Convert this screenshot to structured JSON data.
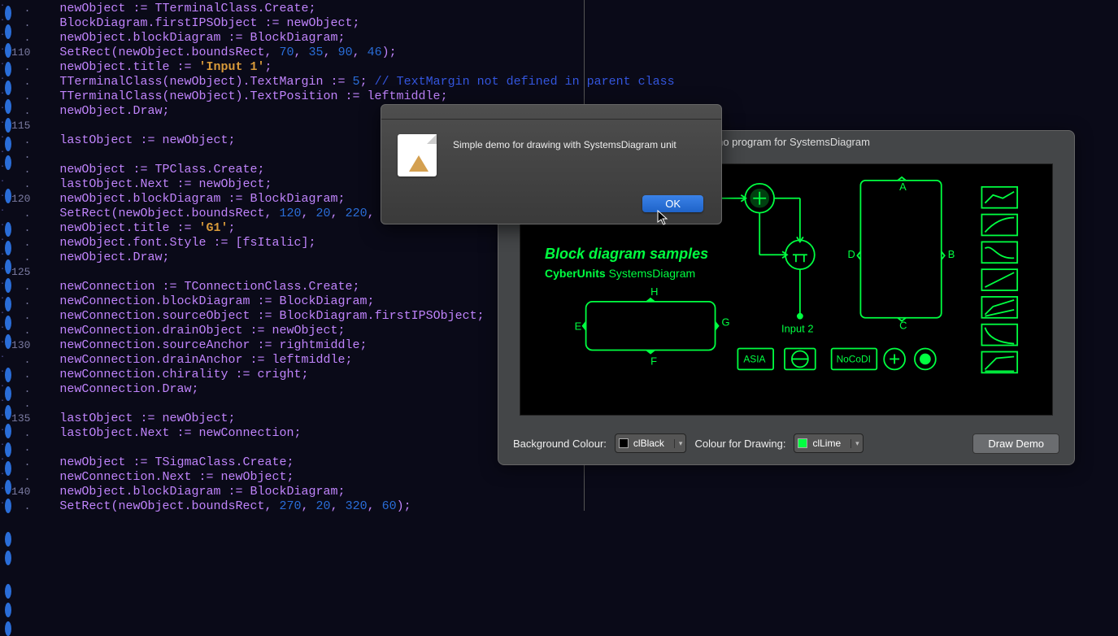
{
  "editor": {
    "first_line": 107,
    "breakpoint_lines": [
      107,
      108,
      109,
      110,
      111,
      112,
      113,
      114,
      115,
      117,
      119,
      120,
      121,
      122,
      123,
      124,
      125,
      127,
      128,
      129,
      130,
      131,
      132,
      133,
      134,
      136,
      137,
      139,
      140,
      141,
      142
    ],
    "lines": [
      {
        "n": 107,
        "t": [
          [
            "newObject ",
            0
          ],
          [
            ":=",
            1
          ],
          [
            " TTerminalClass",
            0
          ],
          [
            ".",
            1
          ],
          [
            "Create",
            0
          ],
          [
            ";",
            1
          ]
        ]
      },
      {
        "n": 108,
        "t": [
          [
            "BlockDiagram",
            0
          ],
          [
            ".",
            1
          ],
          [
            "firstIPSObject ",
            0
          ],
          [
            ":=",
            1
          ],
          [
            " newObject",
            0
          ],
          [
            ";",
            1
          ]
        ]
      },
      {
        "n": 109,
        "t": [
          [
            "newObject",
            0
          ],
          [
            ".",
            1
          ],
          [
            "blockDiagram ",
            0
          ],
          [
            ":=",
            1
          ],
          [
            " BlockDiagram",
            0
          ],
          [
            ";",
            1
          ]
        ]
      },
      {
        "n": 110,
        "t": [
          [
            "SetRect",
            0
          ],
          [
            "(",
            1
          ],
          [
            "newObject",
            0
          ],
          [
            ".",
            1
          ],
          [
            "boundsRect",
            0
          ],
          [
            ", ",
            1
          ],
          [
            "70",
            2
          ],
          [
            ", ",
            1
          ],
          [
            "35",
            2
          ],
          [
            ", ",
            1
          ],
          [
            "90",
            2
          ],
          [
            ", ",
            1
          ],
          [
            "46",
            2
          ],
          [
            ");",
            1
          ]
        ]
      },
      {
        "n": 111,
        "t": [
          [
            "newObject",
            0
          ],
          [
            ".",
            1
          ],
          [
            "title ",
            0
          ],
          [
            ":= ",
            1
          ],
          [
            "'Input 1'",
            3
          ],
          [
            ";",
            1
          ]
        ]
      },
      {
        "n": 112,
        "t": [
          [
            "TTerminalClass",
            0
          ],
          [
            "(",
            1
          ],
          [
            "newObject",
            0
          ],
          [
            ").",
            1
          ],
          [
            "TextMargin ",
            0
          ],
          [
            ":= ",
            1
          ],
          [
            "5",
            2
          ],
          [
            "; ",
            1
          ],
          [
            "// TextMargin not defined in parent class",
            4
          ]
        ]
      },
      {
        "n": 113,
        "t": [
          [
            "TTerminalClass",
            0
          ],
          [
            "(",
            1
          ],
          [
            "newObject",
            0
          ],
          [
            ").",
            1
          ],
          [
            "TextPosition ",
            0
          ],
          [
            ":= ",
            1
          ],
          [
            "leftmiddle",
            0
          ],
          [
            ";",
            1
          ]
        ]
      },
      {
        "n": 114,
        "t": [
          [
            "newObject",
            0
          ],
          [
            ".",
            1
          ],
          [
            "Draw",
            0
          ],
          [
            ";",
            1
          ]
        ]
      },
      {
        "n": 115,
        "t": [
          [
            " ",
            0
          ]
        ]
      },
      {
        "n": 116,
        "t": [
          [
            "lastObject ",
            0
          ],
          [
            ":=",
            1
          ],
          [
            " newObject",
            0
          ],
          [
            ";",
            1
          ]
        ]
      },
      {
        "n": 117,
        "t": [
          [
            " ",
            0
          ]
        ]
      },
      {
        "n": 118,
        "t": [
          [
            "newObject ",
            0
          ],
          [
            ":=",
            1
          ],
          [
            " TPClass",
            0
          ],
          [
            ".",
            1
          ],
          [
            "Create",
            0
          ],
          [
            ";",
            1
          ]
        ]
      },
      {
        "n": 119,
        "t": [
          [
            "lastObject",
            0
          ],
          [
            ".",
            1
          ],
          [
            "Next ",
            0
          ],
          [
            ":=",
            1
          ],
          [
            " newObject",
            0
          ],
          [
            ";",
            1
          ]
        ]
      },
      {
        "n": 120,
        "t": [
          [
            "newObject",
            0
          ],
          [
            ".",
            1
          ],
          [
            "blockDiagram ",
            0
          ],
          [
            ":=",
            1
          ],
          [
            " BlockDiagram",
            0
          ],
          [
            ";",
            1
          ]
        ]
      },
      {
        "n": 121,
        "t": [
          [
            "SetRect",
            0
          ],
          [
            "(",
            1
          ],
          [
            "newObject",
            0
          ],
          [
            ".",
            1
          ],
          [
            "boundsRect",
            0
          ],
          [
            ", ",
            1
          ],
          [
            "120",
            2
          ],
          [
            ", ",
            1
          ],
          [
            "20",
            2
          ],
          [
            ", ",
            1
          ],
          [
            "220",
            2
          ],
          [
            ",",
            1
          ]
        ]
      },
      {
        "n": 122,
        "t": [
          [
            "newObject",
            0
          ],
          [
            ".",
            1
          ],
          [
            "title ",
            0
          ],
          [
            ":= ",
            1
          ],
          [
            "'G1'",
            3
          ],
          [
            ";",
            1
          ]
        ]
      },
      {
        "n": 123,
        "t": [
          [
            "newObject",
            0
          ],
          [
            ".",
            1
          ],
          [
            "font",
            0
          ],
          [
            ".",
            1
          ],
          [
            "Style ",
            0
          ],
          [
            ":= [",
            1
          ],
          [
            "fsItalic",
            0
          ],
          [
            "];",
            1
          ]
        ]
      },
      {
        "n": 124,
        "t": [
          [
            "newObject",
            0
          ],
          [
            ".",
            1
          ],
          [
            "Draw",
            0
          ],
          [
            ";",
            1
          ]
        ]
      },
      {
        "n": 125,
        "t": [
          [
            " ",
            0
          ]
        ]
      },
      {
        "n": 126,
        "t": [
          [
            "newConnection ",
            0
          ],
          [
            ":=",
            1
          ],
          [
            " TConnectionClass",
            0
          ],
          [
            ".",
            1
          ],
          [
            "Create",
            0
          ],
          [
            ";",
            1
          ]
        ]
      },
      {
        "n": 127,
        "t": [
          [
            "newConnection",
            0
          ],
          [
            ".",
            1
          ],
          [
            "blockDiagram ",
            0
          ],
          [
            ":=",
            1
          ],
          [
            " BlockDiagram",
            0
          ],
          [
            ";",
            1
          ]
        ]
      },
      {
        "n": 128,
        "t": [
          [
            "newConnection",
            0
          ],
          [
            ".",
            1
          ],
          [
            "sourceObject ",
            0
          ],
          [
            ":=",
            1
          ],
          [
            " BlockDiagram",
            0
          ],
          [
            ".",
            1
          ],
          [
            "firstIPSObject",
            0
          ],
          [
            ";",
            1
          ]
        ]
      },
      {
        "n": 129,
        "t": [
          [
            "newConnection",
            0
          ],
          [
            ".",
            1
          ],
          [
            "drainObject ",
            0
          ],
          [
            ":=",
            1
          ],
          [
            " newObject",
            0
          ],
          [
            ";",
            1
          ]
        ]
      },
      {
        "n": 130,
        "t": [
          [
            "newConnection",
            0
          ],
          [
            ".",
            1
          ],
          [
            "sourceAnchor ",
            0
          ],
          [
            ":=",
            1
          ],
          [
            " rightmiddle",
            0
          ],
          [
            ";",
            1
          ]
        ]
      },
      {
        "n": 131,
        "t": [
          [
            "newConnection",
            0
          ],
          [
            ".",
            1
          ],
          [
            "drainAnchor ",
            0
          ],
          [
            ":=",
            1
          ],
          [
            " leftmiddle",
            0
          ],
          [
            ";",
            1
          ]
        ]
      },
      {
        "n": 132,
        "t": [
          [
            "newConnection",
            0
          ],
          [
            ".",
            1
          ],
          [
            "chirality ",
            0
          ],
          [
            ":=",
            1
          ],
          [
            " cright",
            0
          ],
          [
            ";",
            1
          ]
        ]
      },
      {
        "n": 133,
        "t": [
          [
            "newConnection",
            0
          ],
          [
            ".",
            1
          ],
          [
            "Draw",
            0
          ],
          [
            ";",
            1
          ]
        ]
      },
      {
        "n": 134,
        "t": [
          [
            " ",
            0
          ]
        ]
      },
      {
        "n": 135,
        "t": [
          [
            "lastObject ",
            0
          ],
          [
            ":=",
            1
          ],
          [
            " newObject",
            0
          ],
          [
            ";",
            1
          ]
        ]
      },
      {
        "n": 136,
        "t": [
          [
            "lastObject",
            0
          ],
          [
            ".",
            1
          ],
          [
            "Next ",
            0
          ],
          [
            ":=",
            1
          ],
          [
            " newConnection",
            0
          ],
          [
            ";",
            1
          ]
        ]
      },
      {
        "n": 137,
        "t": [
          [
            " ",
            0
          ]
        ]
      },
      {
        "n": 138,
        "t": [
          [
            "newObject ",
            0
          ],
          [
            ":=",
            1
          ],
          [
            " TSigmaClass",
            0
          ],
          [
            ".",
            1
          ],
          [
            "Create",
            0
          ],
          [
            ";",
            1
          ]
        ]
      },
      {
        "n": 139,
        "t": [
          [
            "newConnection",
            0
          ],
          [
            ".",
            1
          ],
          [
            "Next ",
            0
          ],
          [
            ":=",
            1
          ],
          [
            " newObject",
            0
          ],
          [
            ";",
            1
          ]
        ]
      },
      {
        "n": 140,
        "t": [
          [
            "newObject",
            0
          ],
          [
            ".",
            1
          ],
          [
            "blockDiagram ",
            0
          ],
          [
            ":=",
            1
          ],
          [
            " BlockDiagram",
            0
          ],
          [
            ";",
            1
          ]
        ]
      },
      {
        "n": 141,
        "t": [
          [
            "SetRect",
            0
          ],
          [
            "(",
            1
          ],
          [
            "newObject",
            0
          ],
          [
            ".",
            1
          ],
          [
            "boundsRect",
            0
          ],
          [
            ", ",
            1
          ],
          [
            "270",
            2
          ],
          [
            ", ",
            1
          ],
          [
            "20",
            2
          ],
          [
            ", ",
            1
          ],
          [
            "320",
            2
          ],
          [
            ", ",
            1
          ],
          [
            "60",
            2
          ],
          [
            ");",
            1
          ]
        ]
      }
    ],
    "line_labels": [
      110,
      115,
      120,
      125,
      130,
      135,
      140
    ]
  },
  "dialog": {
    "message": "Simple demo for drawing with SystemsDiagram unit",
    "ok_label": "OK"
  },
  "demo_window": {
    "title": "demo program for SystemsDiagram",
    "canvas": {
      "title": "Block diagram samples",
      "subtitle_bold": "CyberUnits",
      "subtitle_rest": " SystemsDiagram",
      "labels": {
        "A": "A",
        "B": "B",
        "C": "C",
        "D": "D",
        "E": "E",
        "F": "F",
        "G": "G",
        "H": "H",
        "Input2": "Input 2",
        "ASIA": "ASIA",
        "NoCoDI": "NoCoDI"
      }
    },
    "footer": {
      "bg_label": "Background Colour:",
      "bg_value": "clBlack",
      "fg_label": "Colour for Drawing:",
      "fg_value": "clLime",
      "button": "Draw Demo"
    }
  },
  "colours": {
    "lime": "#00ff41",
    "black": "#000000",
    "accent_blue": "#2a6dd8"
  }
}
